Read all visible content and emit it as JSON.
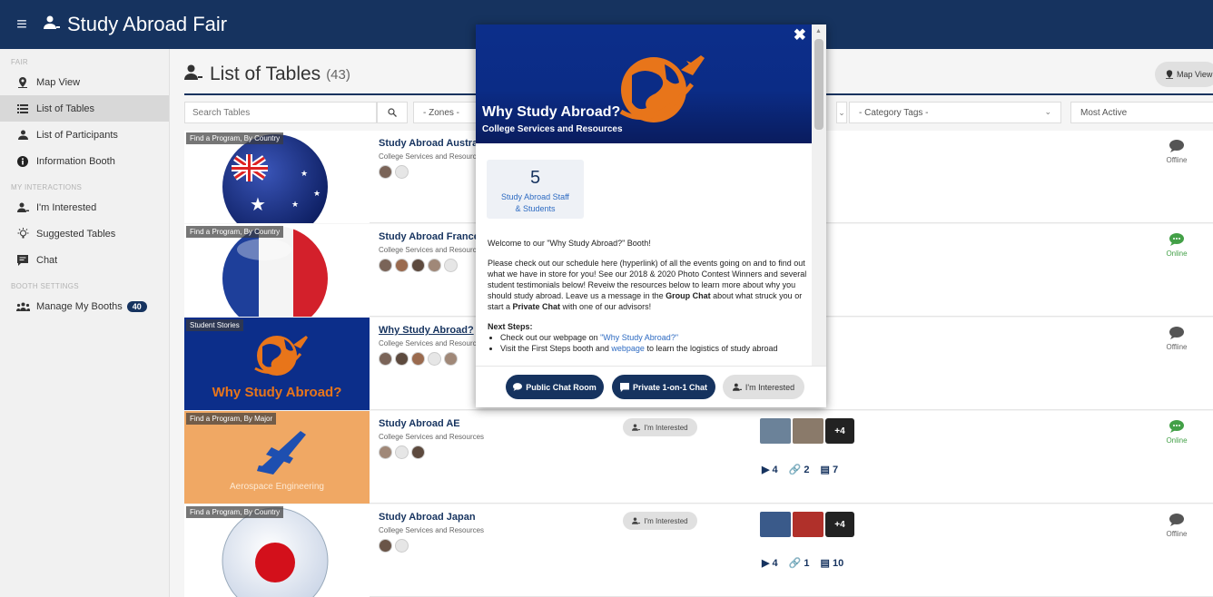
{
  "app": {
    "title": "Study Abroad Fair"
  },
  "sidebar": {
    "sections": [
      {
        "label": "FAIR"
      },
      {
        "label": "MY INTERACTIONS"
      },
      {
        "label": "BOOTH SETTINGS"
      }
    ],
    "items": [
      {
        "label": "Map View",
        "icon": "map-pin-icon"
      },
      {
        "label": "List of Tables",
        "icon": "list-icon",
        "active": true
      },
      {
        "label": "List of Participants",
        "icon": "person-icon"
      },
      {
        "label": "Information Booth",
        "icon": "info-icon"
      },
      {
        "label": "I'm Interested",
        "icon": "person-check-icon"
      },
      {
        "label": "Suggested Tables",
        "icon": "lightbulb-icon"
      },
      {
        "label": "Chat",
        "icon": "chat-icon"
      },
      {
        "label": "Manage My Booths",
        "icon": "group-icon",
        "badge": "40"
      }
    ]
  },
  "main": {
    "title": "List of Tables",
    "count": "(43)",
    "map_button": "Map View",
    "filters": {
      "search_placeholder": "Search Tables",
      "zones": "- Zones -",
      "category": "- Category Tags -",
      "sort": "Most Active"
    },
    "rows": [
      {
        "tag": "Find a Program, By Country",
        "name": "Study Abroad Australia",
        "sub": "College Services and Resources",
        "status": "Offline"
      },
      {
        "tag": "Find a Program, By Country",
        "name": "Study Abroad France",
        "sub": "College Services and Resources",
        "status": "Online"
      },
      {
        "tag": "Student Stories",
        "name": "Why Study Abroad?",
        "sub": "College Services and Resources",
        "thumb_text": "Why Study Abroad?",
        "status": "Offline"
      },
      {
        "tag": "Find a Program, By Major",
        "name": "Study Abroad AE",
        "sub": "College Services and Resources",
        "thumb_text": "Aerospace Engineering",
        "interested": "I'm Interested",
        "media_more": "+4",
        "stats": {
          "videos": "4",
          "links": "2",
          "docs": "7"
        },
        "status": "Online"
      },
      {
        "tag": "Find a Program, By Country",
        "name": "Study Abroad Japan",
        "sub": "College Services and Resources",
        "interested": "I'm Interested",
        "media_more": "+4",
        "stats": {
          "videos": "4",
          "links": "1",
          "docs": "10"
        },
        "status": "Offline"
      }
    ]
  },
  "modal": {
    "title": "Why Study Abroad?",
    "subtitle": "College Services and Resources",
    "staff_count": "5",
    "staff_label_1": "Study Abroad Staff",
    "staff_label_2": "& Students",
    "welcome": "Welcome to our \"Why Study Abroad?\" Booth!",
    "para_a": "Please check out our schedule here (hyperlink) of all the events going on and to find out what we have in store for you! See our 2018 & 2020 Photo Contest Winners and several student testimonials below! Reveiw the resources below to learn more about why you should study abroad. Leave us a message in the ",
    "group_chat": "Group Chat",
    "para_b": " about what struck you or start a ",
    "private_chat": "Private Chat",
    "para_c": " with one of our advisors!",
    "next_steps": "Next Steps:",
    "step1_a": "Check out our webpage on ",
    "step1_link": "\"Why Study Abroad?\"",
    "step2_a": "Visit the First Steps booth and ",
    "step2_link": "webpage",
    "step2_b": " to learn the logistics of study abroad",
    "btn_public": "Public Chat Room",
    "btn_private": "Private 1-on-1 Chat",
    "btn_interested": "I'm Interested"
  },
  "colors": {
    "navy": "#16335f",
    "online": "#43a047",
    "orange": "#e8751a"
  }
}
